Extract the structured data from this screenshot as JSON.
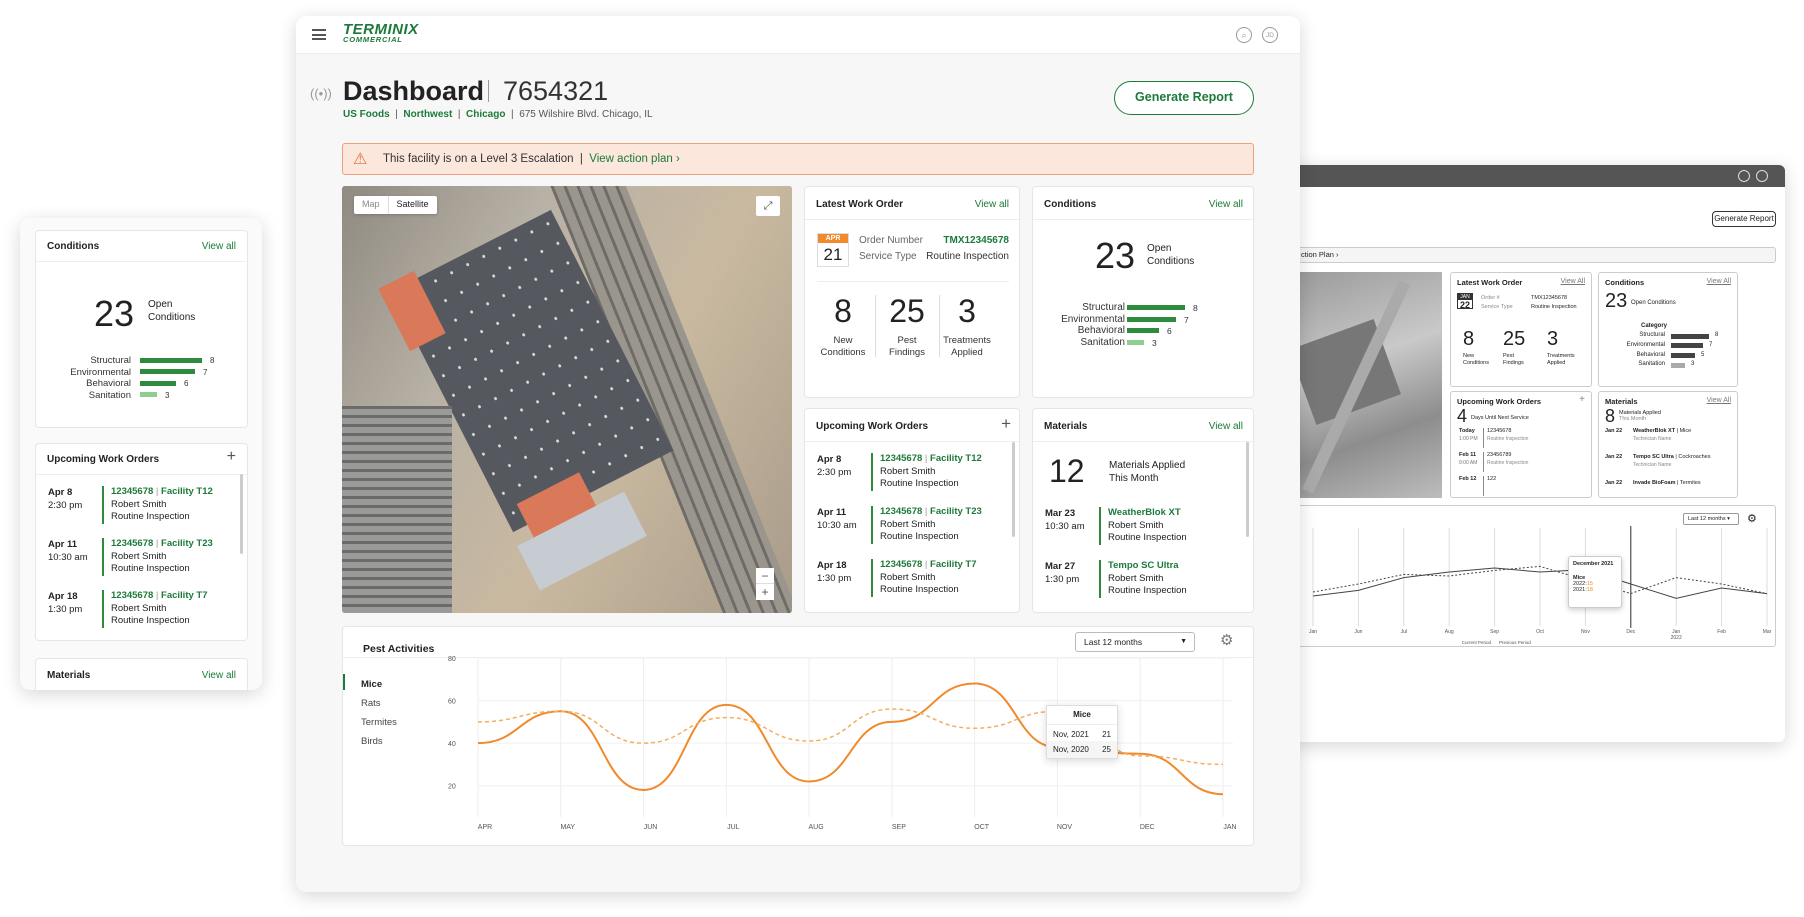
{
  "brand": {
    "name": "TERMINIX",
    "sub": "COMMERCIAL",
    "user_initials": "JD",
    "accent": "#1c7a3a",
    "orange": "#f08a2b"
  },
  "header": {
    "title": "Dashboard",
    "facility_id": "7654321",
    "crumbs": [
      "US Foods",
      "Northwest",
      "Chicago"
    ],
    "address": "675 Wilshire Blvd. Chicago, IL",
    "generate": "Generate Report"
  },
  "alert": {
    "text": "This facility is on a Level 3 Escalation",
    "link": "View action plan"
  },
  "map": {
    "tabs": [
      "Map",
      "Satellite"
    ]
  },
  "latest": {
    "title": "Latest Work Order",
    "view_all": "View all",
    "month": "APR",
    "day": "21",
    "order_label": "Order Number",
    "order_value": "TMX12345678",
    "type_label": "Service Type",
    "type_value": "Routine Inspection",
    "stats": [
      {
        "n": "8",
        "l1": "New",
        "l2": "Conditions"
      },
      {
        "n": "25",
        "l1": "Pest",
        "l2": "Findings"
      },
      {
        "n": "3",
        "l1": "Treatments",
        "l2": "Applied"
      }
    ]
  },
  "conditions": {
    "title": "Conditions",
    "view_all": "View all",
    "count": "23",
    "count_l1": "Open",
    "count_l2": "Conditions",
    "rows": [
      {
        "label": "Structural",
        "value": "8",
        "frac": 1
      },
      {
        "label": "Environmental",
        "value": "7",
        "frac": 0.85
      },
      {
        "label": "Behavioral",
        "value": "6",
        "frac": 0.55
      },
      {
        "label": "Sanitation",
        "value": "3",
        "frac": 0.3
      }
    ]
  },
  "upcoming": {
    "title": "Upcoming Work Orders",
    "items": [
      {
        "date": "Apr 8",
        "time": "2:30 pm",
        "order": "12345678",
        "facility": "Facility T12",
        "tech": "Robert Smith",
        "type": "Routine Inspection"
      },
      {
        "date": "Apr 11",
        "time": "10:30 am",
        "order": "12345678",
        "facility": "Facility T23",
        "tech": "Robert Smith",
        "type": "Routine Inspection"
      },
      {
        "date": "Apr 18",
        "time": "1:30 pm",
        "order": "12345678",
        "facility": "Facility T7",
        "tech": "Robert Smith",
        "type": "Routine Inspection"
      }
    ]
  },
  "materials": {
    "title": "Materials",
    "view_all": "View all",
    "count": "12",
    "l1": "Materials Applied",
    "l2": "This Month",
    "items": [
      {
        "date": "Mar 23",
        "time": "10:30 am",
        "name": "WeatherBlok XT",
        "tech": "Robert Smith",
        "type": "Routine Inspection"
      },
      {
        "date": "Mar 27",
        "time": "1:30 pm",
        "name": "Tempo SC Ultra",
        "tech": "Robert Smith",
        "type": "Routine Inspection"
      }
    ]
  },
  "pest": {
    "title": "Pest Activities",
    "range": "Last 12 months",
    "legend": [
      "Mice",
      "Rats",
      "Termites",
      "Birds"
    ],
    "tooltip": {
      "title": "Mice",
      "rows": [
        {
          "label": "Nov, 2021",
          "value": "21"
        },
        {
          "label": "Nov, 2020",
          "value": "25"
        }
      ]
    }
  },
  "chart_data": {
    "type": "line",
    "x": [
      "APR",
      "MAY",
      "JUN",
      "JUL",
      "AUG",
      "SEP",
      "OCT",
      "NOV",
      "DEC",
      "JAN"
    ],
    "ylim": [
      10,
      80
    ],
    "yticks": [
      20,
      40,
      60,
      80
    ],
    "series": [
      {
        "name": "Mice",
        "style": "solid",
        "color": "#f08a2b",
        "values": [
          40,
          55,
          18,
          58,
          22,
          50,
          68,
          38,
          35,
          16
        ]
      },
      {
        "name": "",
        "style": "dashed",
        "color": "#f0b060",
        "values": [
          50,
          55,
          40,
          52,
          41,
          56,
          47,
          55,
          34,
          30
        ]
      }
    ]
  },
  "right": {
    "generate": "Generate Report",
    "action": "ction Plan ›",
    "latest_title": "Latest Work Order",
    "view_all": "View All",
    "month": "JAN",
    "day": "22",
    "order_label": "Order #",
    "order_value": "TMX12345678",
    "type_label": "Service Type",
    "type_value": "Routine Inspection",
    "stats": [
      {
        "n": "8",
        "l1": "New",
        "l2": "Conditions"
      },
      {
        "n": "25",
        "l1": "Pest",
        "l2": "Findings"
      },
      {
        "n": "3",
        "l1": "Treatments",
        "l2": "Applied"
      }
    ],
    "cond_title": "Conditions",
    "cond_count": "23",
    "cond_label": "Open Conditions",
    "category": "Category",
    "cond_rows": [
      {
        "label": "Structural",
        "value": "8",
        "frac": 1
      },
      {
        "label": "Environmental",
        "value": "7",
        "frac": 0.85
      },
      {
        "label": "Behavioral",
        "value": "5",
        "frac": 0.62
      },
      {
        "label": "Sanitation",
        "value": "3",
        "frac": 0.38
      }
    ],
    "up_title": "Upcoming Work Orders",
    "up_count": "4",
    "up_label": "Days Until Next Service",
    "up_items": [
      {
        "d": "Today",
        "t": "1:00 PM",
        "o": "12345678",
        "s": "Routine Inspection"
      },
      {
        "d": "Feb 11",
        "t": "9:00 AM",
        "o": "23456789",
        "s": "Routine Inspection"
      },
      {
        "d": "Feb 12",
        "t": "",
        "o": "122",
        "s": ""
      }
    ],
    "mat_title": "Materials",
    "mat_count": "8",
    "mat_l1": "Materials Applied",
    "mat_l2": "This Month",
    "mat_items": [
      {
        "d": "Jan 22",
        "n": "WeatherBlok XT",
        "p": "Mice",
        "s": "Technician Name"
      },
      {
        "d": "Jan 22",
        "n": "Tempo SC Ultra",
        "p": "Cockroaches",
        "s": "Technician Name"
      },
      {
        "d": "Jan 22",
        "n": "Invade BioFoam",
        "p": "Termites",
        "s": ""
      }
    ],
    "range": "Last 12 months",
    "tip_title": "December 2021",
    "tip_series": "Mice",
    "tip_rows": [
      {
        "l": "2022:",
        "v": "15"
      },
      {
        "l": "2021:",
        "v": "18"
      }
    ],
    "months": [
      "Jan",
      "Jun",
      "Jul",
      "Aug",
      "Sep",
      "Oct",
      "Nov",
      "Dec",
      "Jan",
      "Feb",
      "Mar"
    ],
    "year": "2022",
    "legend_current": "Current Period",
    "legend_previous": "Previous Period"
  },
  "left": {
    "cond_title": "Conditions",
    "view_all": "View all",
    "count": "23",
    "l1": "Open",
    "l2": "Conditions",
    "rows": [
      {
        "label": "Structural",
        "value": "8",
        "frac": 1
      },
      {
        "label": "Environmental",
        "value": "7",
        "frac": 0.88
      },
      {
        "label": "Behavioral",
        "value": "6",
        "frac": 0.58
      },
      {
        "label": "Sanitation",
        "value": "3",
        "frac": 0.28
      }
    ],
    "up_title": "Upcoming Work Orders",
    "items": [
      {
        "date": "Apr 8",
        "time": "2:30 pm",
        "order": "12345678",
        "facility": "Facility T12",
        "tech": "Robert Smith",
        "type": "Routine Inspection"
      },
      {
        "date": "Apr 11",
        "time": "10:30 am",
        "order": "12345678",
        "facility": "Facility T23",
        "tech": "Robert Smith",
        "type": "Routine Inspection"
      },
      {
        "date": "Apr 18",
        "time": "1:30 pm",
        "order": "12345678",
        "facility": "Facility T7",
        "tech": "Robert Smith",
        "type": "Routine Inspection"
      }
    ],
    "mat_title": "Materials"
  }
}
